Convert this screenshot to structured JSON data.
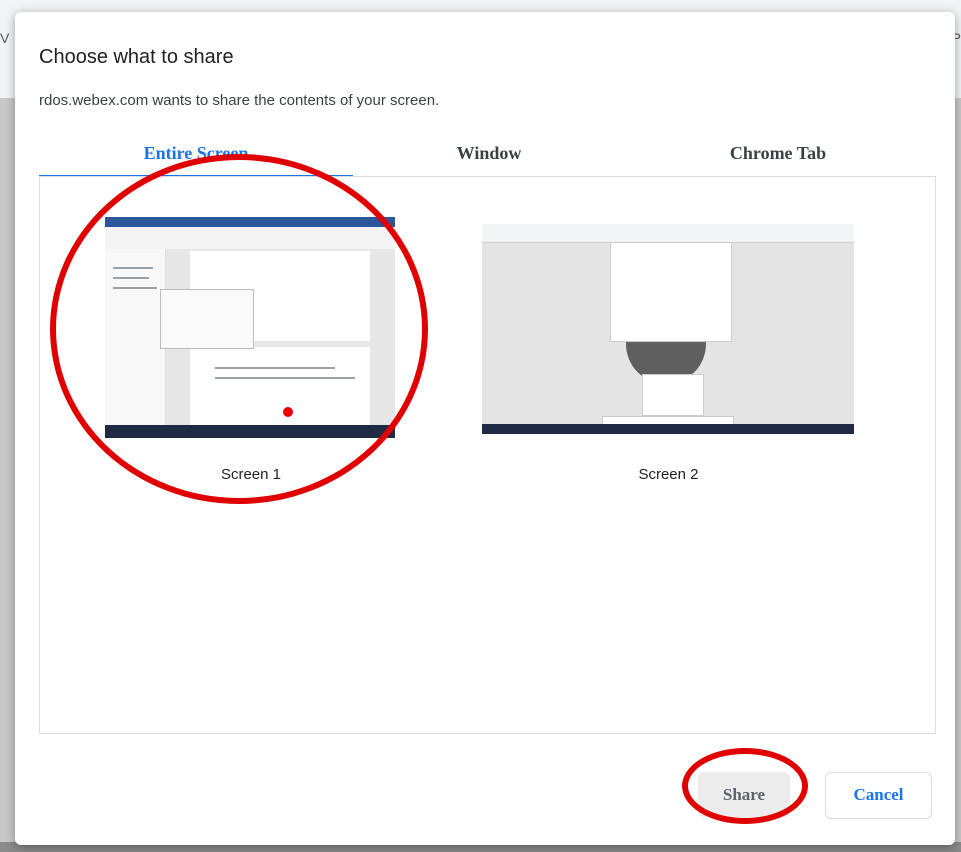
{
  "background": {
    "edge_left": "V",
    "edge_right": "P"
  },
  "dialog": {
    "title": "Choose what to share",
    "subtitle": "rdos.webex.com wants to share the contents of your screen.",
    "tabs": [
      {
        "label": "Entire Screen",
        "selected": true
      },
      {
        "label": "Window",
        "selected": false
      },
      {
        "label": "Chrome Tab",
        "selected": false
      }
    ],
    "screens": [
      {
        "label": "Screen 1"
      },
      {
        "label": "Screen 2"
      }
    ],
    "buttons": {
      "share": "Share",
      "cancel": "Cancel"
    }
  },
  "colors": {
    "accent": "#1a73e8",
    "annotation": "#e00000"
  },
  "icons": [
    "screen-thumbnail"
  ]
}
